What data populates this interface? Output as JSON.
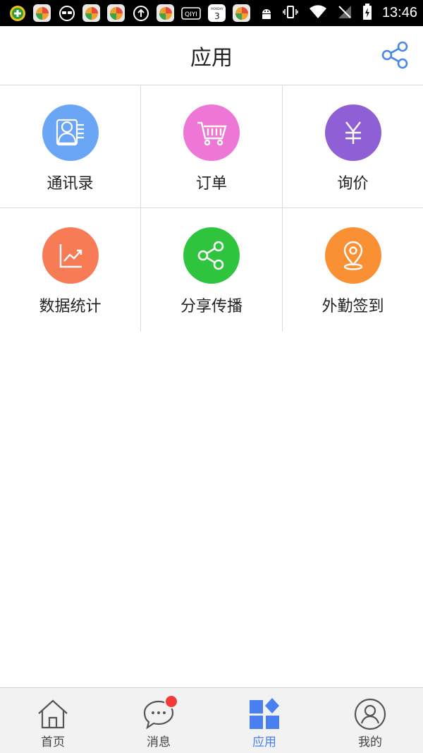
{
  "status_bar": {
    "time": "13:46",
    "calendar_day": "3",
    "calendar_weekday": "MONDAY",
    "iqiyi_label": "QIYI",
    "icons": [
      "plus-circle-icon",
      "app-icon",
      "glasses-icon",
      "app-icon",
      "app-icon",
      "upload-icon",
      "app-icon",
      "iqiyi-icon",
      "calendar-icon",
      "app-icon",
      "android-icon",
      "vibrate-icon",
      "wifi-icon",
      "no-signal-icon",
      "battery-icon"
    ]
  },
  "header": {
    "title": "应用",
    "share_icon": "share-icon"
  },
  "apps": [
    {
      "label": "通讯录",
      "icon": "contacts-icon",
      "color": "#6aa6f5"
    },
    {
      "label": "订单",
      "icon": "cart-icon",
      "color": "#ee76d4"
    },
    {
      "label": "询价",
      "icon": "yen-icon",
      "color": "#8f5fd6"
    },
    {
      "label": "数据统计",
      "icon": "chart-icon",
      "color": "#f77c56"
    },
    {
      "label": "分享传播",
      "icon": "share-icon",
      "color": "#2fc43e"
    },
    {
      "label": "外勤签到",
      "icon": "location-icon",
      "color": "#f99034"
    }
  ],
  "bottom_nav": {
    "items": [
      {
        "label": "首页",
        "icon": "home-icon"
      },
      {
        "label": "消息",
        "icon": "message-icon",
        "badge": true
      },
      {
        "label": "应用",
        "icon": "apps-icon",
        "active": true
      },
      {
        "label": "我的",
        "icon": "profile-icon"
      }
    ],
    "active_color": "#4a7ff0"
  }
}
